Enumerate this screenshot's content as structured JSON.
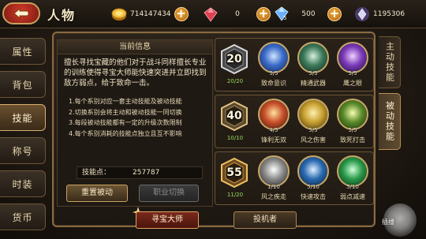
{
  "header": {
    "title": "人物",
    "resources": [
      {
        "icon": "gold-coin-icon",
        "value": "714147434"
      },
      {
        "icon": "red-gem-icon",
        "value": "0"
      },
      {
        "icon": "blue-diamond-icon",
        "value": "500",
        "badge": "5"
      },
      {
        "icon": "silver-crystal-icon",
        "value": "1195306"
      }
    ]
  },
  "sidebar": {
    "items": [
      {
        "label": "属性"
      },
      {
        "label": "背包"
      },
      {
        "label": "技能"
      },
      {
        "label": "称号"
      },
      {
        "label": "时装"
      },
      {
        "label": "货币"
      }
    ],
    "active_index": 2
  },
  "info": {
    "heading": "当前信息",
    "description": "擅长寻找宝藏的他们对于战斗同样擅长专业的训练使得寻宝大师能快速突进并立即找到敌方弱点，给于致命一击。",
    "rules": [
      "1.每个系别对应一套主动技能及被动技能",
      "2.切换系别会将主动和被动技能一同切换",
      "3.每段被动技能都有一定的升级次数限制",
      "4.每个系别消耗的技能点独立且互不影响"
    ],
    "points_label": "技能点：",
    "points_value": "257787",
    "reset_label": "重置被动",
    "switch_label": "职业切换"
  },
  "skill_rows": [
    {
      "level": "20",
      "progress": "20/20",
      "skills": [
        {
          "name": "致命意识",
          "count": "5/5",
          "icon": "flame-sword-icon",
          "color": "#3a6ac8"
        },
        {
          "name": "精通武器",
          "count": "5/5",
          "icon": "daggers-icon",
          "color": "#3c7a5a"
        },
        {
          "name": "鹰之眼",
          "count": "5/5",
          "icon": "eye-orb-icon",
          "color": "#7a3ab8"
        }
      ]
    },
    {
      "level": "40",
      "progress": "10/10",
      "skills": [
        {
          "name": "锋利无双",
          "count": "4/5",
          "icon": "fire-slash-icon",
          "color": "#c8502a"
        },
        {
          "name": "风之伤害",
          "count": "5/5",
          "icon": "wind-helmet-icon",
          "color": "#c8a030"
        },
        {
          "name": "致死打击",
          "count": "5/5",
          "icon": "gold-strike-icon",
          "color": "#5a8a2a"
        }
      ]
    },
    {
      "level": "55",
      "progress": "11/20",
      "skills": [
        {
          "name": "风之疾走",
          "count": "1/10",
          "icon": "wing-icon",
          "color": "#8a8a8a"
        },
        {
          "name": "快速攻击",
          "count": "5/10",
          "icon": "book-blade-icon",
          "color": "#2a6ab0"
        },
        {
          "name": "弱点减速",
          "count": "5/10",
          "icon": "green-swirl-icon",
          "color": "#2a9a4a"
        }
      ]
    }
  ],
  "right_tabs": [
    {
      "label": "主动技能",
      "active": false
    },
    {
      "label": "被动技能",
      "active": true
    }
  ],
  "footer": {
    "treasure_label": "寻宝大师",
    "invest_label": "投机者",
    "float_label": "插播"
  },
  "colors": {
    "accent_gold": "#c8a060",
    "progress_green": "#9bdc58",
    "active_tab": "#6a5030"
  }
}
